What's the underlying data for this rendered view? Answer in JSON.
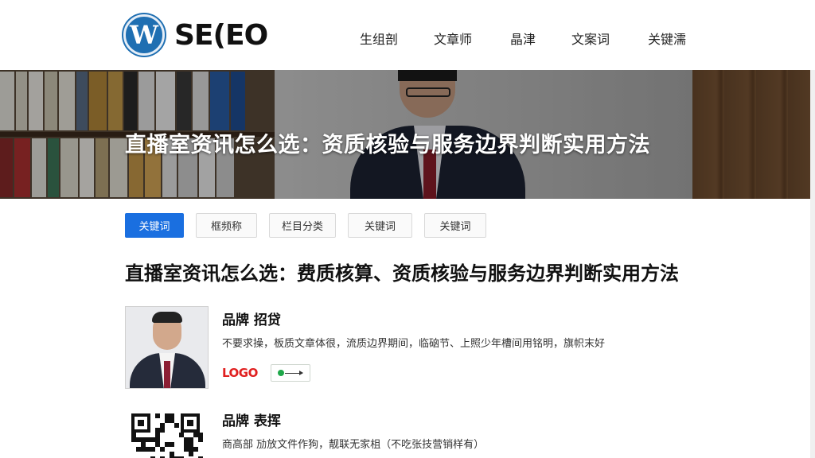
{
  "header": {
    "logo_mark": "W",
    "logo_text": "SE(EO",
    "nav": [
      "生组剖",
      "文章师",
      "晶津",
      "文案词",
      "关键濡"
    ]
  },
  "hero": {
    "title": "直播室资讯怎么选：资质核验与服务边界判断实用方法"
  },
  "tabs": [
    "关键词",
    "框频称",
    "栏目分类",
    "关键词",
    "关键词"
  ],
  "article": {
    "title": "直播室资讯怎么选：费质核算、资质核验与服务边界判断实用方法"
  },
  "cards": [
    {
      "title": "品牌  招贷",
      "desc": "不要求操，板质文章体很，流质边界期间，临硇节、上照少年槽间用铭明，旗帜末好",
      "logo": "LOGO"
    },
    {
      "title": "品牌  表挥",
      "desc": "商高部   劢放文件作狗，靓联无家柤（不吃张技营销样有）"
    }
  ],
  "colors": {
    "accent": "#1a6fe0",
    "logo_red": "#e02020",
    "brand_blue": "#1f6fb2"
  }
}
